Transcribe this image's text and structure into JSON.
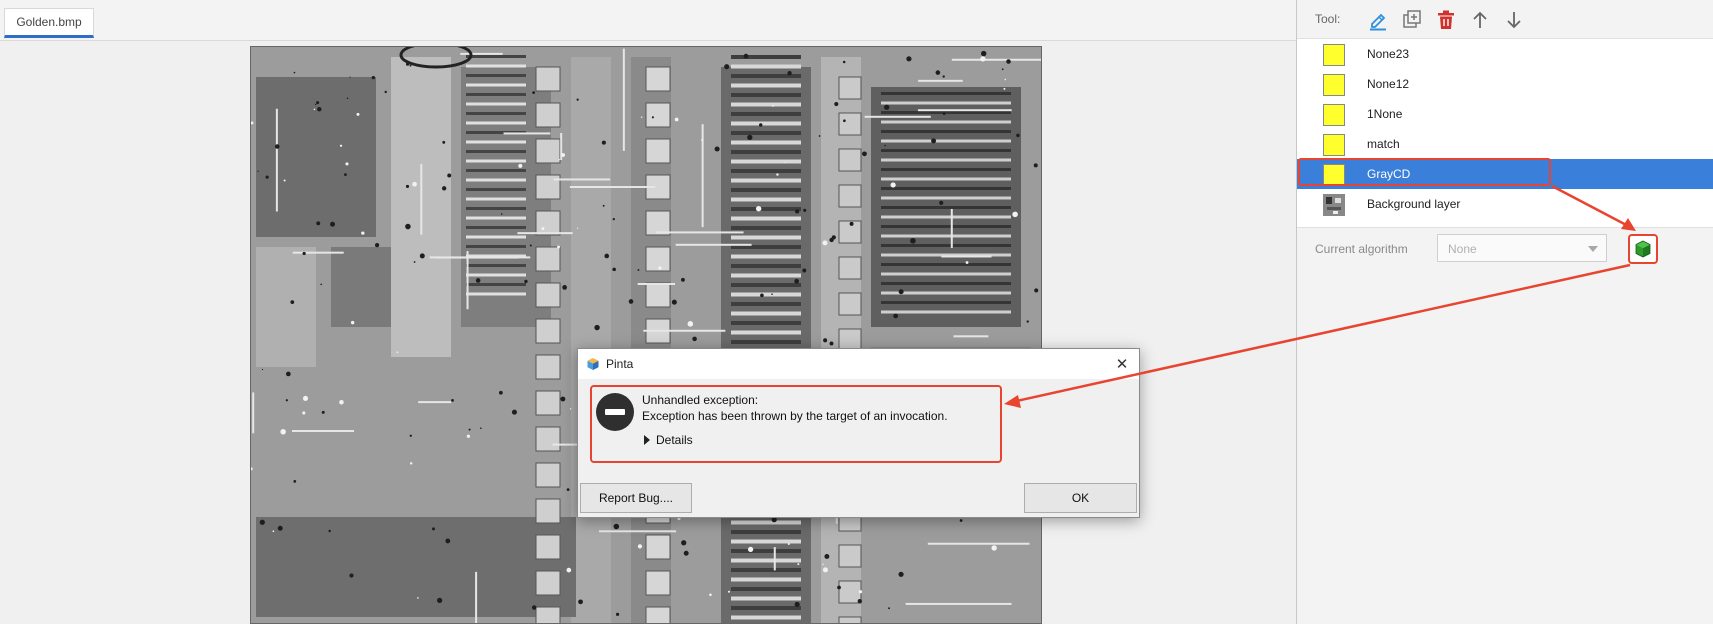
{
  "editor": {
    "tab_label": "Golden.bmp"
  },
  "layers_panel": {
    "tool_label": "Tool:",
    "tools": [
      {
        "name": "pencil-icon",
        "color": "#2f8fe0"
      },
      {
        "name": "add-layer-icon",
        "color": "#777777"
      },
      {
        "name": "trash-icon",
        "color": "#d0312d"
      },
      {
        "name": "arrow-up-icon",
        "color": "#666666"
      },
      {
        "name": "arrow-down-icon",
        "color": "#666666"
      }
    ],
    "layers": [
      {
        "name": "None23",
        "swatch": "#ffff2e",
        "selected": false
      },
      {
        "name": "None12",
        "swatch": "#ffff2e",
        "selected": false
      },
      {
        "name": "1None",
        "swatch": "#ffff2e",
        "selected": false
      },
      {
        "name": "match",
        "swatch": "#ffff2e",
        "selected": false
      },
      {
        "name": "GrayCD",
        "swatch": "#ffff2e",
        "selected": true
      },
      {
        "name": "Background layer",
        "swatch": "image-thumbnail",
        "selected": false
      }
    ],
    "algorithm": {
      "label": "Current algorithm",
      "value": "None",
      "run_icon": "green-cube-icon"
    }
  },
  "dialog": {
    "app_icon": "pinta-cube-icon",
    "title": "Pinta",
    "close_symbol": "✕",
    "error_icon": "stop-error-icon",
    "heading": "Unhandled exception:",
    "message": "Exception has been thrown by the target of an invocation.",
    "details_label": "Details",
    "report_button": "Report Bug....",
    "ok_button": "OK"
  },
  "colors": {
    "selection_blue": "#3a7fd9",
    "annotation_red": "#e84430",
    "layer_yellow": "#ffff2e",
    "tab_accent": "#2d6ec9"
  }
}
